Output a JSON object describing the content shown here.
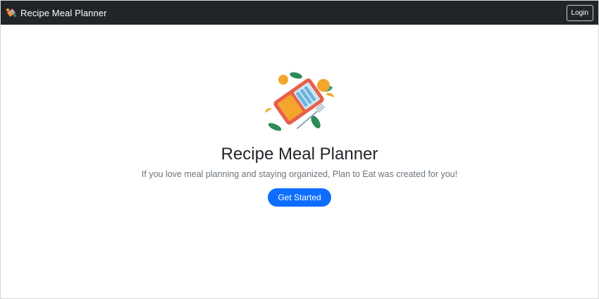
{
  "navbar": {
    "brand": "Recipe Meal Planner",
    "brand_icon": "meal-tray-icon",
    "login_label": "Login",
    "background": "#212529"
  },
  "hero": {
    "illustration": "meal-tray-illustration",
    "title": "Recipe Meal Planner",
    "subtitle": "If you love meal planning and staying organized, Plan to Eat was created for you!",
    "cta_label": "Get Started",
    "cta_color": "#0d6efd"
  }
}
